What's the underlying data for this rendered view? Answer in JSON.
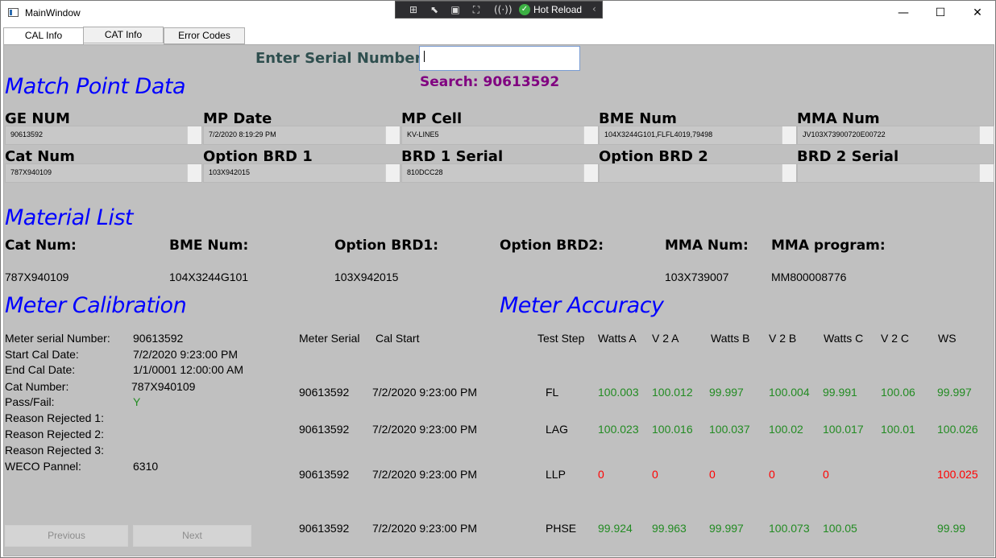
{
  "window": {
    "title": "MainWindow"
  },
  "devbar": {
    "hot_reload": "Hot Reload"
  },
  "tabs": [
    {
      "label": "CAL Info"
    },
    {
      "label": "CAT Info"
    },
    {
      "label": "Error Codes"
    }
  ],
  "search": {
    "label": "Enter Serial Number:",
    "value": "",
    "result": "Search: 90613592"
  },
  "match_point": {
    "title": "Match Point Data",
    "fields": [
      {
        "label": "GE NUM",
        "value": "90613592"
      },
      {
        "label": "MP Date",
        "value": "7/2/2020 8:19:29 PM"
      },
      {
        "label": "MP Cell",
        "value": "KV-LINE5"
      },
      {
        "label": "BME Num",
        "value": "104X3244G101,FLFL4019,79498"
      },
      {
        "label": "MMA Num",
        "value": "JV103X73900720E00722"
      },
      {
        "label": "Cat Num",
        "value": "787X940109"
      },
      {
        "label": "Option BRD 1",
        "value": "103X942015"
      },
      {
        "label": "BRD 1 Serial",
        "value": "810DCC28"
      },
      {
        "label": "Option BRD 2",
        "value": ""
      },
      {
        "label": "BRD 2 Serial",
        "value": ""
      }
    ]
  },
  "material": {
    "title": "Material List",
    "labels": [
      "Cat Num:",
      "BME Num:",
      "Option BRD1:",
      "Option BRD2:",
      "MMA Num:",
      "MMA program:"
    ],
    "values": [
      "787X940109",
      "104X3244G101",
      "103X942015",
      "",
      "103X739007",
      "MM800008776"
    ]
  },
  "calibration": {
    "title": "Meter Calibration",
    "meter_serial_label": "Meter serial Number:",
    "meter_serial_value": "90613592",
    "start_label": "Start Cal Date:",
    "start_value": "7/2/2020 9:23:00 PM",
    "end_label": "End Cal Date:",
    "end_value": "1/1/0001 12:00:00 AM",
    "cat_label": "Cat Number:",
    "cat_value": "787X940109",
    "pass_label": "Pass/Fail:",
    "pass_value": "Y",
    "reason1_label": "Reason Rejected 1:",
    "reason2_label": "Reason Rejected 2:",
    "reason3_label": "Reason Rejected 3:",
    "weco_label": "WECO Pannel:",
    "weco_value": "6310",
    "headers": {
      "serial": "Meter Serial",
      "cal_start": "Cal Start"
    },
    "rows": [
      {
        "serial": "90613592",
        "cal_start": "7/2/2020 9:23:00 PM"
      },
      {
        "serial": "90613592",
        "cal_start": "7/2/2020 9:23:00 PM"
      },
      {
        "serial": "90613592",
        "cal_start": "7/2/2020 9:23:00 PM"
      },
      {
        "serial": "90613592",
        "cal_start": "7/2/2020 9:23:00 PM"
      }
    ],
    "prev_label": "Previous",
    "next_label": "Next"
  },
  "accuracy": {
    "title": "Meter Accuracy",
    "headers": [
      "Test Step",
      "Watts A",
      "V 2 A",
      "Watts B",
      "V 2 B",
      "Watts C",
      "V 2 C",
      "WS"
    ],
    "rows": [
      {
        "step": "FL",
        "values": [
          "100.003",
          "100.012",
          "99.997",
          "100.004",
          "99.991",
          "100.06",
          "99.997"
        ]
      },
      {
        "step": "LAG",
        "values": [
          "100.023",
          "100.016",
          "100.037",
          "100.02",
          "100.017",
          "100.01",
          "100.026"
        ]
      },
      {
        "step": "LLP",
        "values": [
          "0",
          "0",
          "0",
          "0",
          "0",
          "",
          "100.025"
        ]
      },
      {
        "step": "PHSE",
        "values": [
          "99.924",
          "99.963",
          "99.997",
          "100.073",
          "100.05",
          "",
          "99.99"
        ]
      }
    ]
  },
  "colors": {
    "pass": "#228b22",
    "fail": "#ff0000",
    "section_title": "#0000ff",
    "search_result": "#800080"
  }
}
